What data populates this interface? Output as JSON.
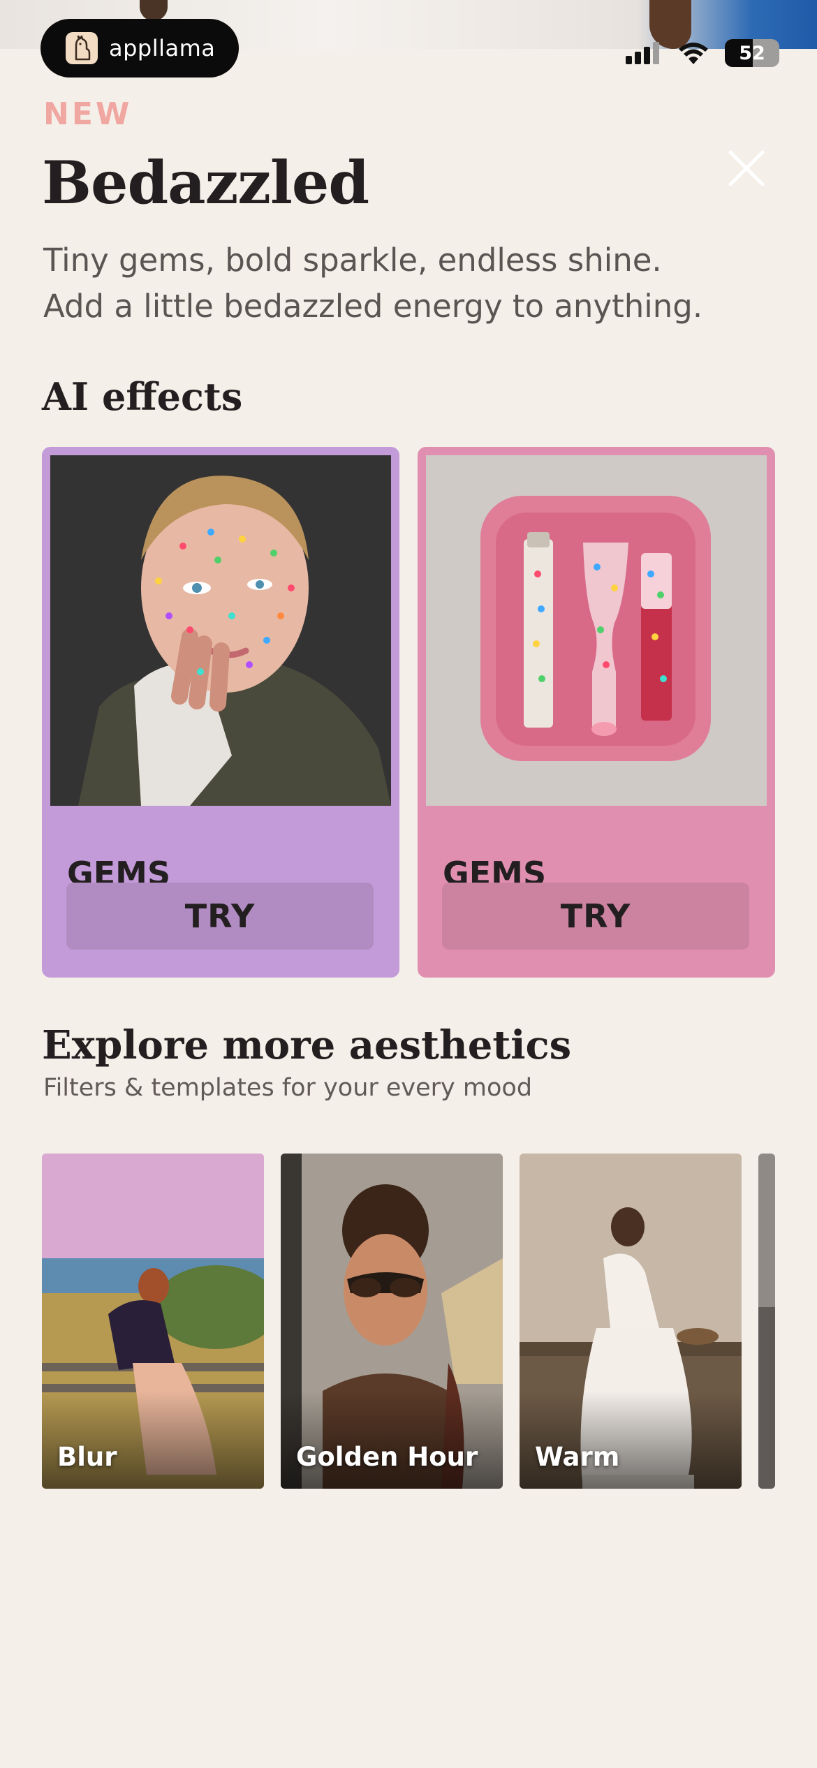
{
  "brand": {
    "name": "appllama"
  },
  "status_bar": {
    "battery": "52",
    "battery_level": 0.52
  },
  "header": {
    "tag": "NEW",
    "title": "Bedazzled",
    "subtitle_lines": [
      "Tiny gems, bold sparkle, endless shine.",
      "Add a little bedazzled energy to anything."
    ]
  },
  "ai_effects": {
    "title": "AI effects",
    "cards": [
      {
        "label": "GEMS",
        "button": "TRY",
        "bg": "#c49bd9",
        "button_bg": "#b18cc3"
      },
      {
        "label": "GEMS",
        "button": "TRY",
        "bg": "#e08fb0",
        "button_bg": "#cc83a0"
      }
    ]
  },
  "explore": {
    "title": "Explore more aesthetics",
    "subtitle": "Filters & templates for your every mood",
    "items": [
      {
        "label": "Blur"
      },
      {
        "label": "Golden Hour"
      },
      {
        "label": "Warm"
      }
    ]
  },
  "colors": {
    "background": "#f5efe9",
    "new_tag": "#f0a6a1",
    "text": "#231f20"
  }
}
